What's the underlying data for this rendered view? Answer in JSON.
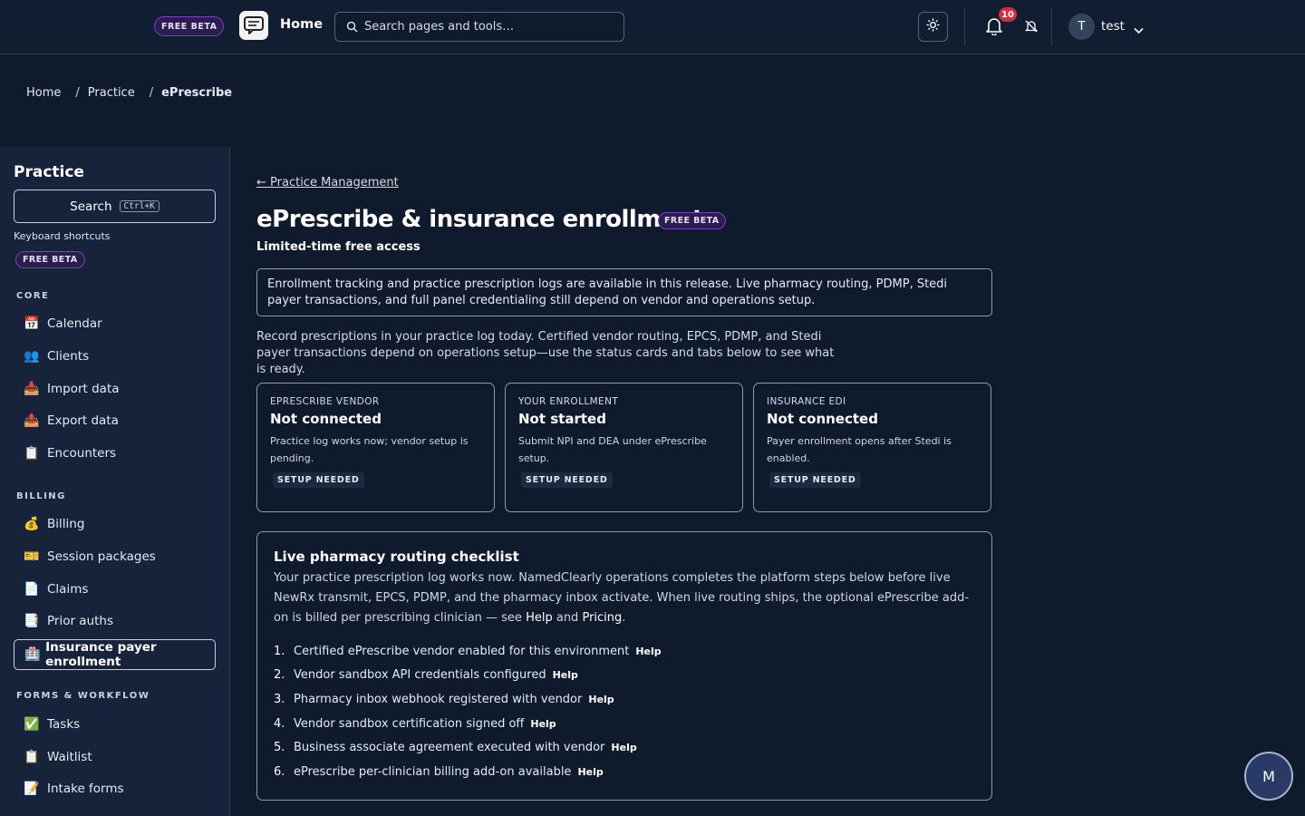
{
  "topbar": {
    "beta_label": "FREE BETA",
    "app_title": "Home",
    "search_placeholder": "Search pages and tools…",
    "notifications_count": "10",
    "avatar_initial": "T",
    "user_name": "test"
  },
  "breadcrumb": [
    "Home",
    "Practice",
    "ePrescribe"
  ],
  "sidebar": {
    "title": "Practice",
    "search_label": "Search",
    "search_shortcut": "Ctrl+K",
    "shortcuts_label": "Keyboard shortcuts",
    "beta_label": "FREE BETA",
    "sections": {
      "core": "CORE",
      "billing": "BILLING",
      "forms": "FORMS & WORKFLOW"
    },
    "items": [
      {
        "label": "Calendar",
        "icon": "📅"
      },
      {
        "label": "Clients",
        "icon": "👥"
      },
      {
        "label": "Import data",
        "icon": "📥"
      },
      {
        "label": "Export data",
        "icon": "📤"
      },
      {
        "label": "Encounters",
        "icon": "📋"
      },
      {
        "label": "Billing",
        "icon": "💰"
      },
      {
        "label": "Session packages",
        "icon": "🎫"
      },
      {
        "label": "Claims",
        "icon": "📄"
      },
      {
        "label": "Prior auths",
        "icon": "📑"
      },
      {
        "label": "Insurance payer enrollment",
        "icon": "🏥"
      },
      {
        "label": "Tasks",
        "icon": "✅"
      },
      {
        "label": "Waitlist",
        "icon": "📋"
      },
      {
        "label": "Intake forms",
        "icon": "📝"
      }
    ]
  },
  "main": {
    "back_link": "← Practice Management",
    "title": "ePrescribe & insurance enrollment",
    "title_badge": "FREE BETA",
    "subtitle": "Limited-time free access",
    "notice": "Enrollment tracking and practice prescription logs are available in this release. Live pharmacy routing, PDMP, Stedi payer transactions, and full panel credentialing still depend on vendor and operations setup.",
    "intro": "Record prescriptions in your practice log today. Certified vendor routing, EPCS, PDMP, and Stedi payer transactions depend on operations setup—use the status cards and tabs below to see what is ready.",
    "cards": [
      {
        "eyebrow": "EPRESCRIBE VENDOR",
        "status": "Not connected",
        "desc": "Practice log works now; vendor setup is pending.",
        "tag": "SETUP NEEDED"
      },
      {
        "eyebrow": "YOUR ENROLLMENT",
        "status": "Not started",
        "desc": "Submit NPI and DEA under ePrescribe setup.",
        "tag": "SETUP NEEDED"
      },
      {
        "eyebrow": "INSURANCE EDI",
        "status": "Not connected",
        "desc": "Payer enrollment opens after Stedi is enabled.",
        "tag": "SETUP NEEDED"
      }
    ],
    "checklist": {
      "title": "Live pharmacy routing checklist",
      "desc_before": "Your practice prescription log works now. NamedClearly operations completes the platform steps below before live NewRx transmit, EPCS, PDMP, and the pharmacy inbox activate. When live routing ships, the optional ePrescribe add-on is billed per prescribing clinician — see ",
      "help_link": "Help",
      "and": " and ",
      "pricing_link": "Pricing",
      "desc_after": ".",
      "help_label": "Help",
      "items": [
        {
          "num": "1.",
          "text": "Certified ePrescribe vendor enabled for this environment"
        },
        {
          "num": "2.",
          "text": "Vendor sandbox API credentials configured"
        },
        {
          "num": "3.",
          "text": "Pharmacy inbox webhook registered with vendor"
        },
        {
          "num": "4.",
          "text": "Vendor sandbox certification signed off"
        },
        {
          "num": "5.",
          "text": "Business associate agreement executed with vendor"
        },
        {
          "num": "6.",
          "text": "ePrescribe per-clinician billing add-on available"
        }
      ]
    }
  },
  "fab_label": "M"
}
